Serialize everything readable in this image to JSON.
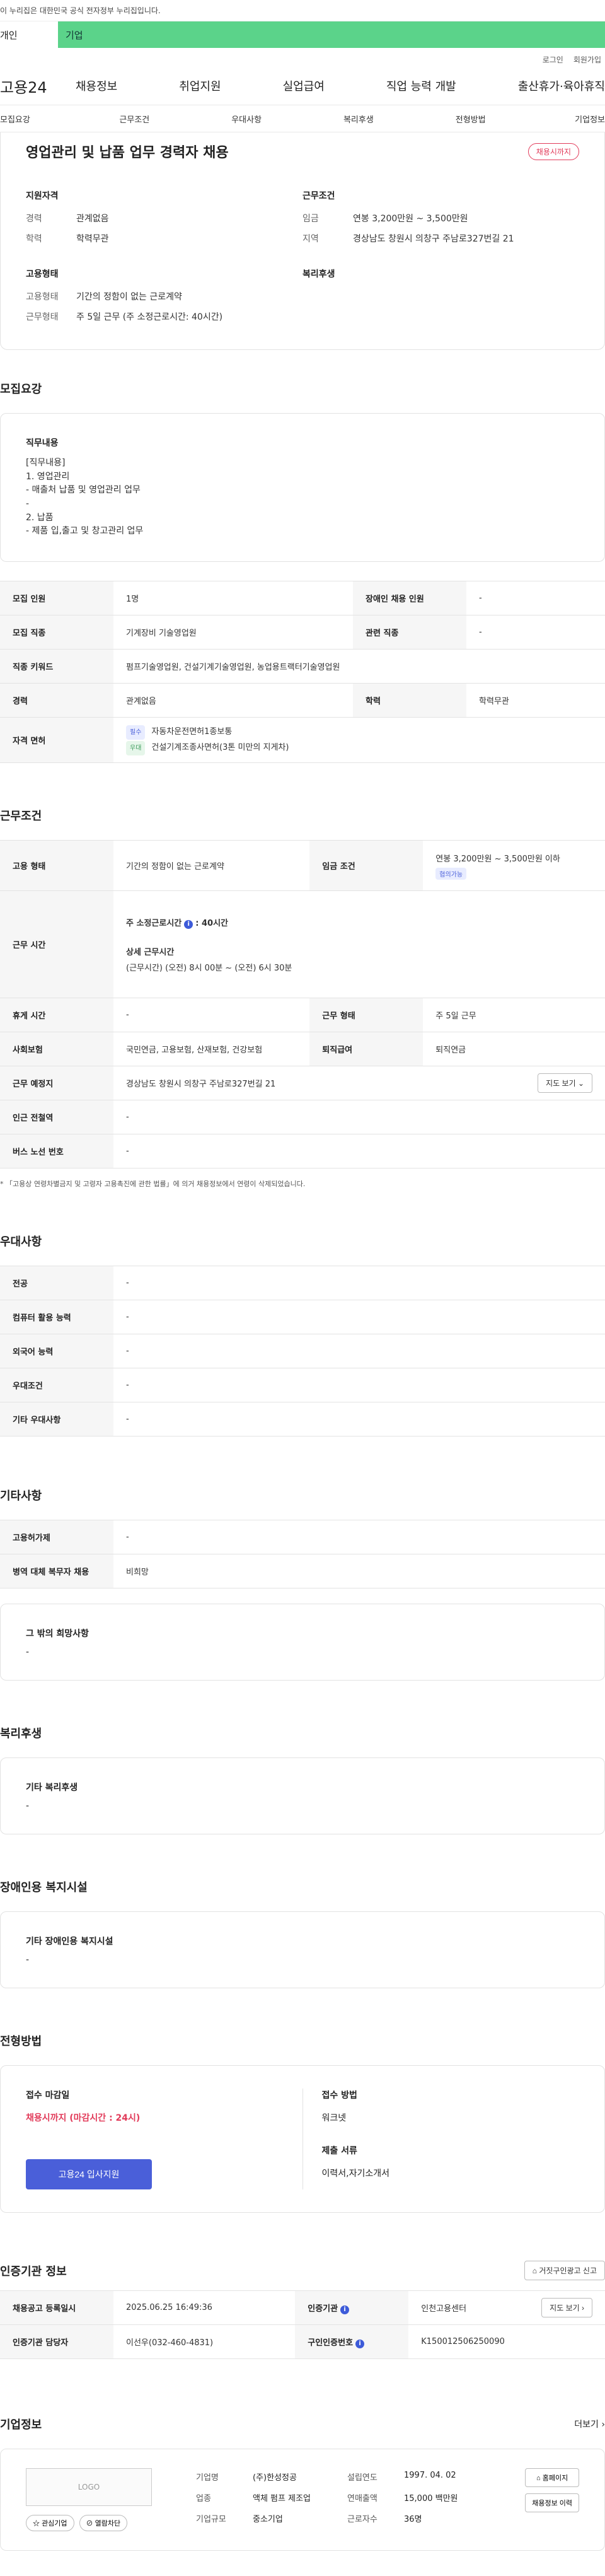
{
  "topbar": {
    "notice": "이 누리집은 대한민국 공식 전자정부 누리집입니다."
  },
  "toptabs": {
    "person": "개인",
    "company": "기업"
  },
  "util": {
    "login": "로그인",
    "join": "회원가입"
  },
  "gnb": {
    "logo": "고용24",
    "menu": [
      "채용정보",
      "취업지원",
      "실업급여",
      "직업 능력 개발",
      "출산휴가·육아휴직"
    ]
  },
  "subnav": [
    "모집요강",
    "근무조건",
    "우대사항",
    "복리후생",
    "전형방법",
    "기업정보"
  ],
  "summary": {
    "title": "영업관리 및 납품 업무 경력자 채용",
    "badge": "채용시까지",
    "qual_title": "지원자격",
    "qual": [
      {
        "k": "경력",
        "v": "관계없음"
      },
      {
        "k": "학력",
        "v": "학력무관"
      }
    ],
    "cond_title": "근무조건",
    "cond": [
      {
        "k": "임금",
        "v": "연봉 3,200만원 ~ 3,500만원"
      },
      {
        "k": "지역",
        "v": "경상남도 창원시 의창구 주남로327번길 21"
      }
    ],
    "emp_title": "고용형태",
    "emp": [
      {
        "k": "고용형태",
        "v": "기간의 정함이 없는 근로계약"
      },
      {
        "k": "근무형태",
        "v": "주 5일 근무 (주 소정근로시간: 40시간)"
      }
    ],
    "welfare_title": "복리후생"
  },
  "recruit": {
    "title": "모집요강",
    "job_title": "직무내용",
    "job_body": "[직무내용]\n1. 영업관리\n- 매출처 납품 및 영업관리 업무\n-\n2. 납품\n- 제품 입,출고 및 창고관리 업무",
    "rows": {
      "count_k": "모집 인원",
      "count_v": "1명",
      "disabled_k": "장애인 채용 인원",
      "disabled_v": "-",
      "job_k": "모집 직종",
      "job_v": "기계장비 기술영업원",
      "related_k": "관련 직종",
      "related_v": "-",
      "keyword_k": "직종 키워드",
      "keyword_v": "펌프기술영업원, 건설기계기술영업원, 농업용트랙터기술영업원",
      "career_k": "경력",
      "career_v": "관계없음",
      "edu_k": "학력",
      "edu_v": "학력무관",
      "license_k": "자격 면허",
      "lic1_tag": "필수",
      "lic1": "자동차운전면허1종보통",
      "lic2_tag": "우대",
      "lic2": "건설기계조종사면허(3톤 미만의 지게차)"
    }
  },
  "work": {
    "title": "근무조건",
    "emp_k": "고용 형태",
    "emp_v": "기간의 정함이 없는 근로계약",
    "wage_k": "임금 조건",
    "wage_v": "연봉 3,200만원 ~ 3,500만원 이하",
    "wage_tag": "협의가능",
    "hours_k": "근무 시간",
    "hours_main_a": "주 소정근로시간",
    "hours_main_b": ": 40시간",
    "hours_detail_t": "상세 근무시간",
    "hours_detail": "(근무시간) (오전) 8시 00분 ~ (오전) 6시 30분",
    "break_k": "휴게 시간",
    "break_v": "-",
    "form_k": "근무 형태",
    "form_v": "주 5일 근무",
    "ins_k": "사회보험",
    "ins_v": "국민연금, 고용보험, 산재보험, 건강보험",
    "ret_k": "퇴직급여",
    "ret_v": "퇴직연금",
    "loc_k": "근무 예정지",
    "loc_v": "경상남도 창원시 의창구 주남로327번길 21",
    "map_btn": "지도 보기",
    "subway_k": "인근 전철역",
    "subway_v": "-",
    "bus_k": "버스 노선 번호",
    "bus_v": "-",
    "note": "* 「고용상 연령차별금지 및 고령자 고용촉진에 관한 법률」에 의거 채용정보에서 연령이 삭제되었습니다."
  },
  "pref": {
    "title": "우대사항",
    "rows": [
      {
        "k": "전공",
        "v": "-"
      },
      {
        "k": "컴퓨터 활용 능력",
        "v": "-"
      },
      {
        "k": "외국어 능력",
        "v": "-"
      },
      {
        "k": "우대조건",
        "v": "-"
      },
      {
        "k": "기타 우대사항",
        "v": "-"
      }
    ]
  },
  "etc": {
    "title": "기타사항",
    "rows": [
      {
        "k": "고용허가제",
        "v": "-"
      },
      {
        "k": "병역 대체 복무자 채용",
        "v": "비희망"
      }
    ],
    "wish_t": "그 밖의 희망사항",
    "wish_v": "-"
  },
  "welfare": {
    "title": "복리후생",
    "box_t": "기타 복리후생",
    "box_v": "-"
  },
  "disabled": {
    "title": "장애인용 복지시설",
    "box_t": "기타 장애인용 복지시설",
    "box_v": "-"
  },
  "apply": {
    "title": "전형방법",
    "deadline_t": "접수 마감일",
    "deadline_v": "채용시까지 (마감시간 : 24시)",
    "btn": "고용24 입사지원",
    "method_t": "접수 방법",
    "method_v": "워크넷",
    "docs_t": "제출 서류",
    "docs_v": "이력서,자기소개서"
  },
  "cert": {
    "title": "인증기관 정보",
    "report_btn": "거짓구인광고 신고",
    "reg_k": "채용공고 등록일시",
    "reg_v": "2025.06.25 16:49:36",
    "org_k": "인증기관",
    "org_v": "인천고용센터",
    "map_btn": "지도 보기",
    "mgr_k": "인증기관 담당자",
    "mgr_v": "이선우(032-460-4831)",
    "num_k": "구인인증번호",
    "num_v": "K150012506250090"
  },
  "company": {
    "title": "기업정보",
    "more": "더보기",
    "logo": "LOGO",
    "fav": "관심기업",
    "block": "열람차단",
    "name_k": "기업명",
    "name_v": "(주)한성정공",
    "year_k": "설립연도",
    "year_v": "1997. 04. 02",
    "biz_k": "업종",
    "biz_v": "액체 펌프 제조업",
    "sales_k": "연매출액",
    "sales_v": "15,000 백만원",
    "size_k": "기업규모",
    "size_v": "중소기업",
    "emp_k": "근로자수",
    "emp_v": "36명",
    "home_btn": "홈페이지",
    "history_btn": "채용정보 이력"
  }
}
